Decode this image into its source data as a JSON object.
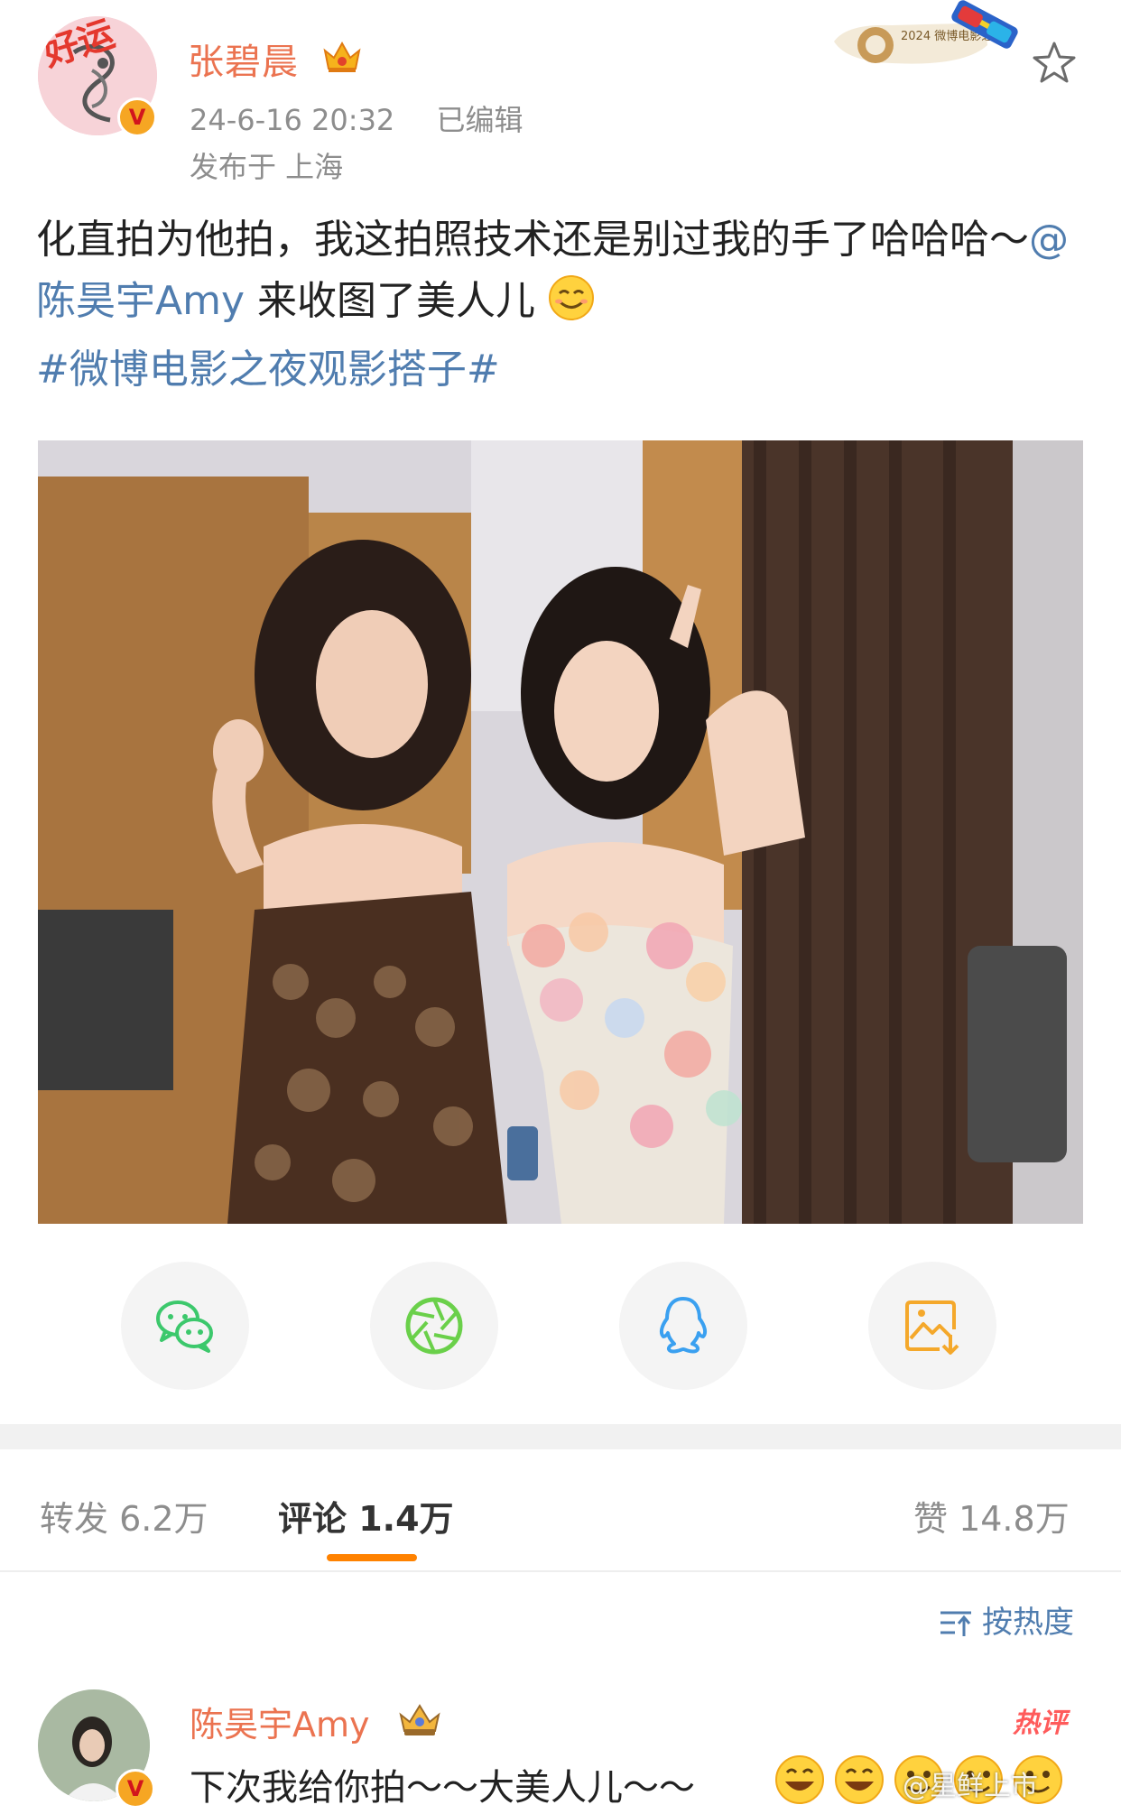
{
  "post": {
    "author": "张碧晨",
    "timestamp": "24-6-16 20:32",
    "edited": "已编辑",
    "location": "发布于 上海",
    "text_part1": "化直拍为他拍，我这拍照技术还是别过我的手了哈哈哈～",
    "mention": "@陈昊宇Amy",
    "text_part2": " 来收图了美人儿",
    "hashtag": "#微博电影之夜观影搭子#",
    "avatar_overlay": "好运",
    "verified_mark": "V",
    "photo_alt": "Two women posing backstage, one in a sequined brown strapless dress waving, the other in a floral pink strapless gown making a peace sign",
    "event_badge": "2024 微博电影之夜"
  },
  "share_buttons": [
    {
      "name": "wechat-share",
      "icon": "wechat-icon",
      "color": "#3cc86c"
    },
    {
      "name": "moments-share",
      "icon": "aperture-icon",
      "color": "#6ad04a"
    },
    {
      "name": "qq-share",
      "icon": "qq-penguin-icon",
      "color": "#3aa0f0"
    },
    {
      "name": "save-image",
      "icon": "save-image-icon",
      "color": "#f4a82b"
    }
  ],
  "tabs": {
    "repost": "转发 6.2万",
    "comment": "评论 1.4万",
    "like": "赞 14.8万"
  },
  "sort_label": "按热度",
  "comment": {
    "author": "陈昊宇Amy",
    "badge": "热评",
    "text": "下次我给你拍～～大美人儿～～"
  },
  "watermark": "@星鲜上市",
  "colors": {
    "username": "#eb7350",
    "link": "#507daf",
    "accent": "#ff8200"
  }
}
